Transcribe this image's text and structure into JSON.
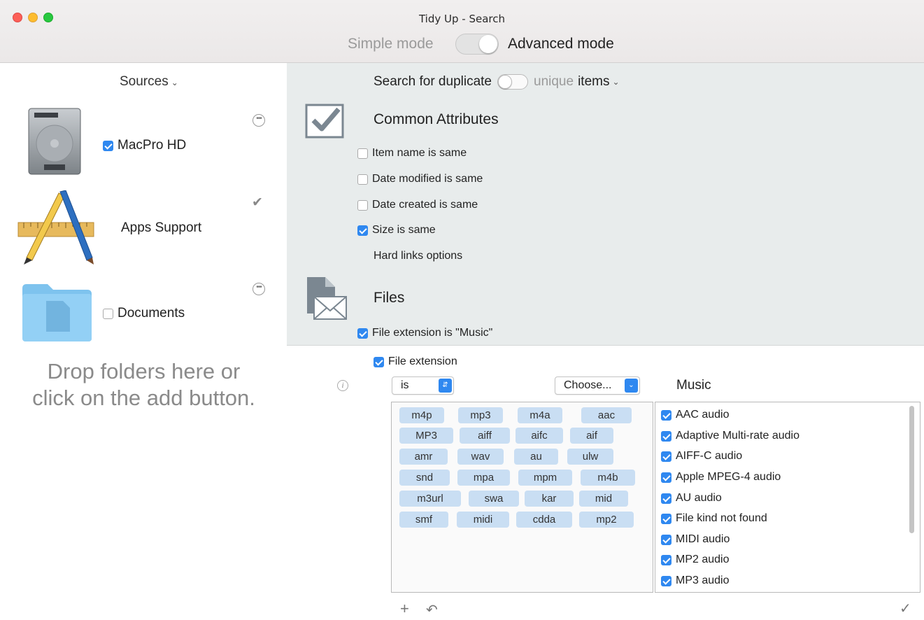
{
  "window": {
    "title": "Tidy Up - Search",
    "mode_simple": "Simple mode",
    "mode_advanced": "Advanced mode"
  },
  "sidebar": {
    "header": "Sources",
    "sources": [
      {
        "label": "MacPro HD",
        "checked": true
      },
      {
        "label": "Apps Support"
      },
      {
        "label": "Documents",
        "checked": false
      }
    ],
    "drop_line1": "Drop folders here or",
    "drop_line2": "click on the add button."
  },
  "search": {
    "prefix": "Search for duplicate",
    "unique": "unique",
    "items": "items"
  },
  "common": {
    "title": "Common Attributes",
    "attrs": [
      {
        "label": "Item name is same",
        "checked": false
      },
      {
        "label": "Date modified is same",
        "checked": false
      },
      {
        "label": "Date created is same",
        "checked": false
      },
      {
        "label": "Size is same",
        "checked": true
      }
    ],
    "hard_links": "Hard links options"
  },
  "files": {
    "title": "Files",
    "ext_summary": "File extension is \"Music\"",
    "ext_option": "File extension",
    "operator": "is",
    "choose": "Choose...",
    "kind_header": "Music",
    "extensions": [
      "m4p",
      "mp3",
      "m4a",
      "aac",
      "MP3",
      "aiff",
      "aifc",
      "aif",
      "amr",
      "wav",
      "au",
      "ulw",
      "snd",
      "mpa",
      "mpm",
      "m4b",
      "m3url",
      "swa",
      "kar",
      "mid",
      "smf",
      "midi",
      "cdda",
      "mp2"
    ],
    "kinds": [
      "AAC audio",
      "Adaptive Multi-rate audio",
      "AIFF-C audio",
      "Apple MPEG-4 audio",
      "AU audio",
      "File kind not found",
      "MIDI audio",
      "MP2 audio",
      "MP3 audio"
    ]
  },
  "colors": {
    "accent": "#2f88f0",
    "tag_bg": "#c9def3",
    "panel_bg": "#e8ecec"
  }
}
